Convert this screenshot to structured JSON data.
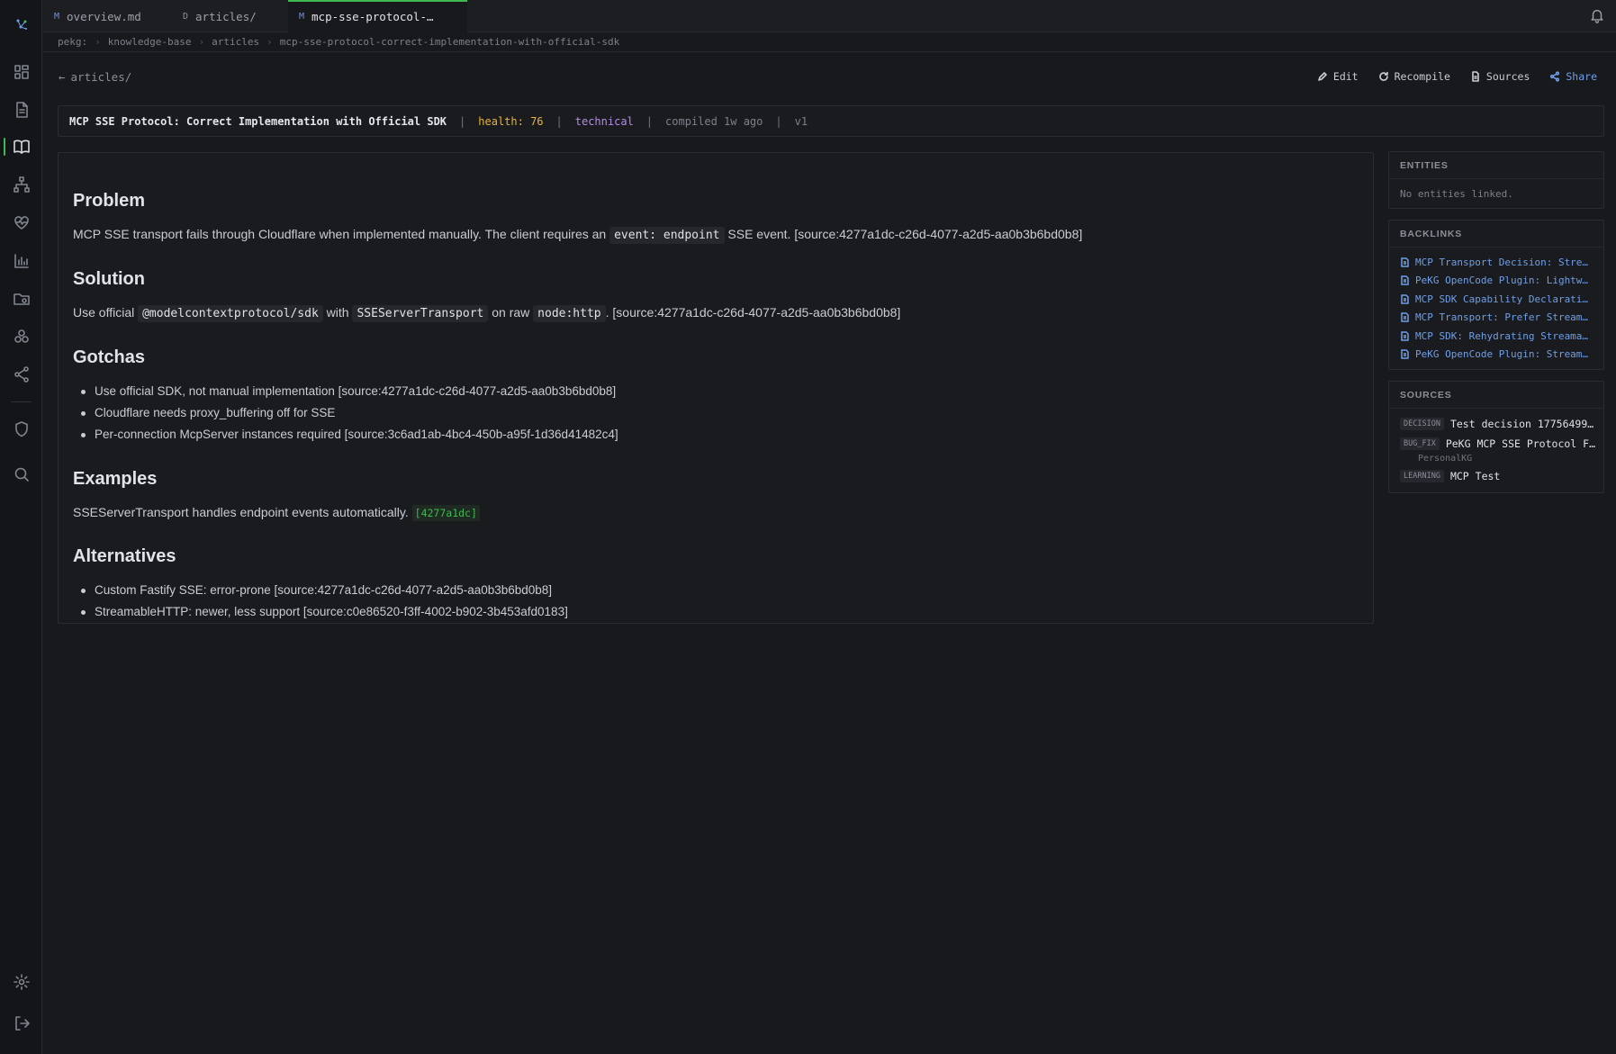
{
  "tabs": [
    {
      "kind": "M",
      "label": "overview.md"
    },
    {
      "kind": "D",
      "label": "articles/"
    },
    {
      "kind": "M",
      "label": "mcp-sse-protocol-…"
    }
  ],
  "breadcrumb": [
    "pekg:",
    "knowledge-base",
    "articles",
    "mcp-sse-protocol-correct-implementation-with-official-sdk"
  ],
  "back_label": "articles/",
  "actions": {
    "edit": "Edit",
    "recompile": "Recompile",
    "sources": "Sources",
    "share": "Share"
  },
  "meta": {
    "title": "MCP SSE Protocol: Correct Implementation with Official SDK",
    "sep": "|",
    "health": "health: 76",
    "type": "technical",
    "compiled": "compiled 1w ago",
    "version": "v1"
  },
  "article": {
    "problem": {
      "heading": "Problem",
      "text_a": "MCP SSE transport fails through Cloudflare when implemented manually. The client requires an",
      "code": "event: endpoint",
      "text_b": "SSE event. [source:4277a1dc-c26d-4077-a2d5-aa0b3b6bd0b8]"
    },
    "solution": {
      "heading": "Solution",
      "t1": "Use official",
      "c1": "@modelcontextprotocol/sdk",
      "t2": "with",
      "c2": "SSEServerTransport",
      "t3": "on raw",
      "c3": "node:http",
      "t4": ". [source:4277a1dc-c26d-4077-a2d5-aa0b3b6bd0b8]"
    },
    "gotchas": {
      "heading": "Gotchas",
      "items": [
        "Use official SDK, not manual implementation [source:4277a1dc-c26d-4077-a2d5-aa0b3b6bd0b8]",
        "Cloudflare needs proxy_buffering off for SSE",
        "Per-connection McpServer instances required [source:3c6ad1ab-4bc4-450b-a95f-1d36d41482c4]"
      ]
    },
    "examples": {
      "heading": "Examples",
      "text": "SSEServerTransport handles endpoint events automatically.",
      "cite": "[4277a1dc]"
    },
    "alternatives": {
      "heading": "Alternatives",
      "items": [
        "Custom Fastify SSE: error-prone [source:4277a1dc-c26d-4077-a2d5-aa0b3b6bd0b8]",
        "StreamableHTTP: newer, less support [source:c0e86520-f3ff-4002-b902-3b453afd0183]"
      ]
    }
  },
  "entities": {
    "heading": "ENTITIES",
    "empty": "No entities linked."
  },
  "backlinks": {
    "heading": "BACKLINKS",
    "items": [
      "MCP Transport Decision: Stre…",
      "PeKG OpenCode Plugin: Lightw…",
      "MCP SDK Capability Declarati…",
      "MCP Transport: Prefer Stream…",
      "MCP SDK: Rehydrating Streama…",
      "PeKG OpenCode Plugin: Stream…"
    ]
  },
  "sources": {
    "heading": "SOURCES",
    "items": [
      {
        "tag": "DECISION",
        "title": "Test decision 17756499…",
        "sub": ""
      },
      {
        "tag": "BUG_FIX",
        "title": "PeKG MCP SSE Protocol F…",
        "sub": "PersonalKG"
      },
      {
        "tag": "LEARNING",
        "title": "MCP Test",
        "sub": ""
      }
    ]
  },
  "colors": {
    "accent_green": "#3fb950",
    "link_blue": "#6f9fe8",
    "health_yellow": "#e3b341",
    "type_purple": "#b58be6"
  }
}
